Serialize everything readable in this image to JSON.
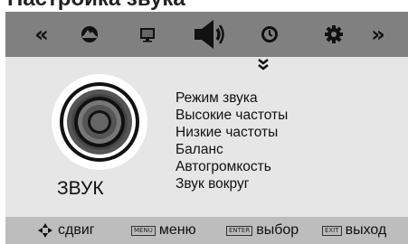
{
  "toolbar": {
    "items": [
      {
        "name": "prev-page-icon",
        "glyph": "«"
      },
      {
        "name": "picture-icon"
      },
      {
        "name": "screen-icon"
      },
      {
        "name": "sound-icon",
        "active": true
      },
      {
        "name": "clock-icon"
      },
      {
        "name": "gear-icon"
      },
      {
        "name": "next-page-icon",
        "glyph": "»"
      }
    ]
  },
  "page": {
    "title": "ЗВУК"
  },
  "menu": {
    "items": [
      "Режим звука",
      "Высокие частоты",
      "Низкие частоты",
      "Баланс",
      "Автогромкость",
      "Звук вокруг"
    ]
  },
  "footer": {
    "move": {
      "label": "сдвиг"
    },
    "menu": {
      "key": "MENU",
      "label": "меню"
    },
    "enter": {
      "key": "ENTER",
      "label": "выбор"
    },
    "exit": {
      "key": "EXIT",
      "label": "выход"
    }
  },
  "colors": {
    "toolbar_bg": "#808080",
    "panel_bg": "#e6e6e6",
    "footer_bg": "#bdbdbd",
    "text": "#111111"
  }
}
